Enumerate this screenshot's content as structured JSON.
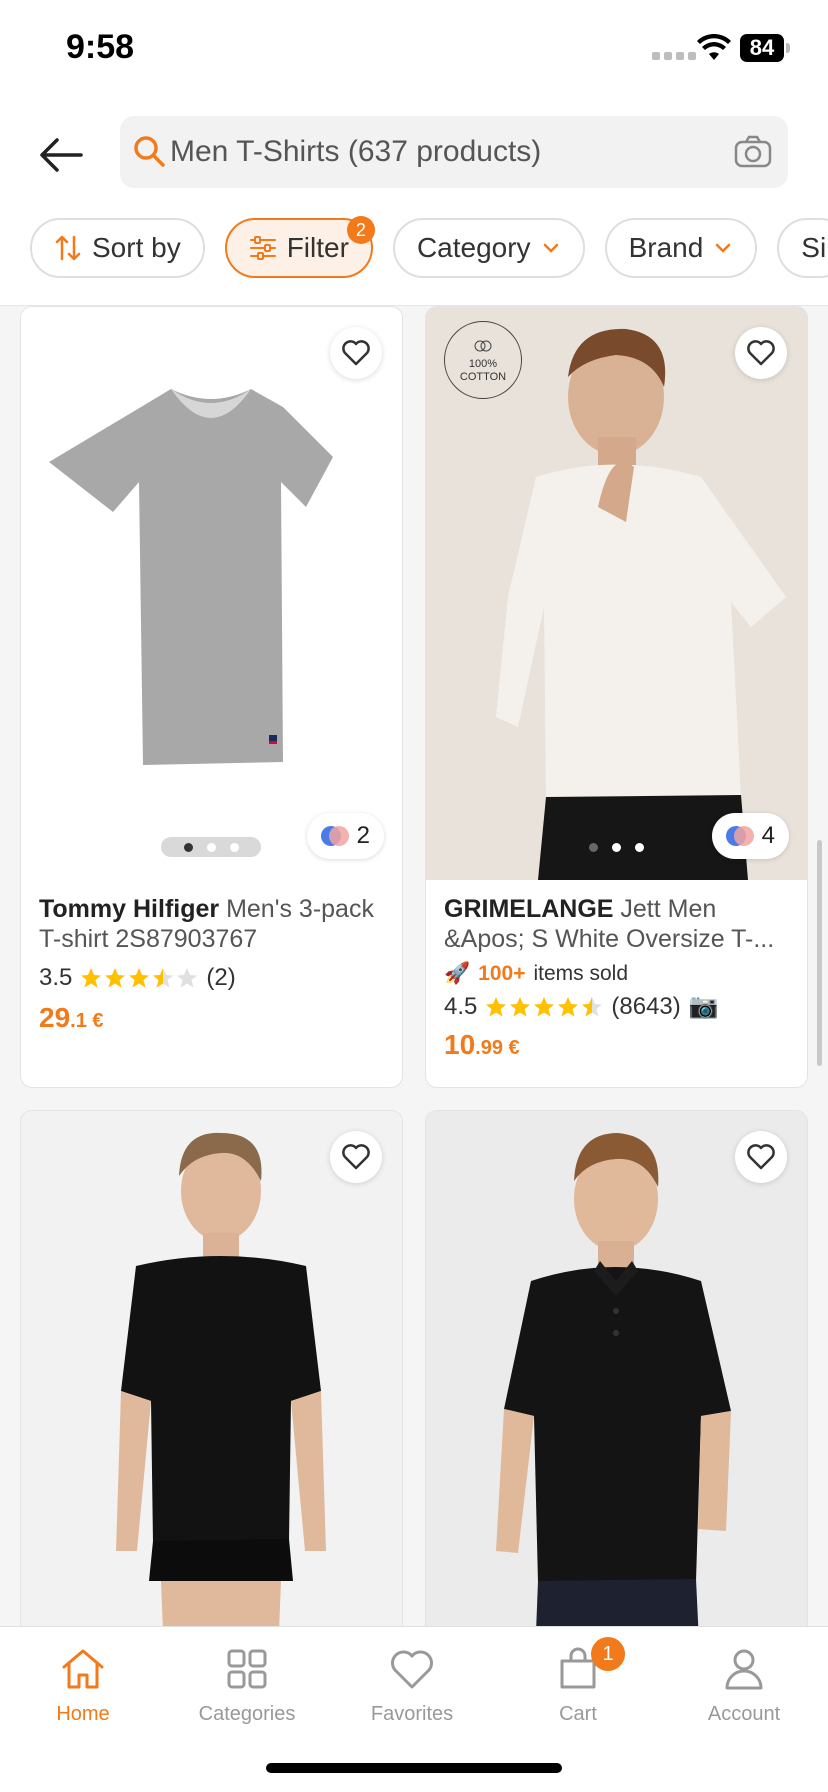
{
  "status_bar": {
    "time": "9:58",
    "battery": "84"
  },
  "header": {
    "search_text": "Men T-Shirts (637 products)",
    "filters": [
      {
        "label": "Sort by",
        "icon": "sort-icon"
      },
      {
        "label": "Filter",
        "icon": "filter-icon",
        "badge": "2",
        "active": true
      },
      {
        "label": "Category",
        "icon": "chevron-down-icon"
      },
      {
        "label": "Brand",
        "icon": "chevron-down-icon"
      },
      {
        "label": "Si",
        "icon": ""
      }
    ]
  },
  "products": [
    {
      "brand": "Tommy Hilfiger",
      "name": " Men's 3-pack T-shirt 2S87903767",
      "rating": "3.5",
      "reviews": "(2)",
      "price_main": "29",
      "price_decimal": ".1 €",
      "colors": "2"
    },
    {
      "brand": "GRIMELANGE",
      "name": " Jett Men &Apos; S White Oversize T-...",
      "sold_count": "100+",
      "sold_label": "items sold",
      "rating": "4.5",
      "reviews": "(8643)",
      "price_main": "10",
      "price_decimal": ".99 €",
      "colors": "4",
      "badge_text": "100% COTTON"
    },
    {},
    {}
  ],
  "bottom_nav": {
    "home": "Home",
    "categories": "Categories",
    "favorites": "Favorites",
    "cart": "Cart",
    "cart_badge": "1",
    "account": "Account"
  },
  "colors": {
    "accent": "#f27a1a"
  }
}
